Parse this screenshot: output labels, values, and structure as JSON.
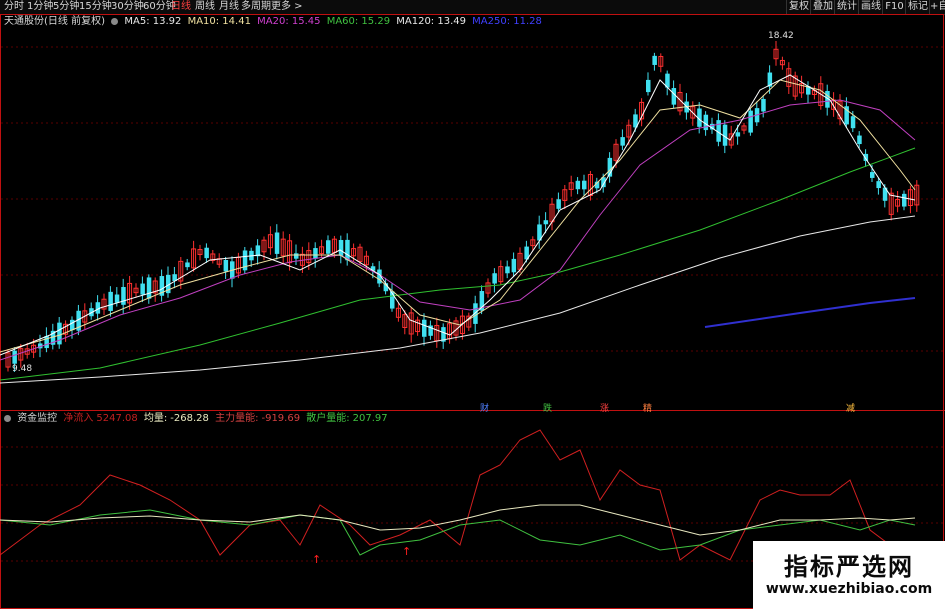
{
  "toolbar": {
    "left_tabs": [
      "分时",
      "1分钟",
      "5分钟",
      "15分钟",
      "30分钟",
      "60分钟",
      "日线",
      "周线",
      "月线",
      "多周期",
      "更多 >"
    ],
    "active_tab": "日线",
    "right_buttons": [
      "复权",
      "叠加",
      "统计",
      "画线",
      "F10",
      "标记",
      "+自"
    ]
  },
  "main_panel": {
    "title": "天通股份(日线 前复权)",
    "ma_legend": [
      {
        "label": "MA5: 13.92",
        "color": "#e8e8e8"
      },
      {
        "label": "MA10: 14.41",
        "color": "#f0e0a0"
      },
      {
        "label": "MA20: 15.45",
        "color": "#d040d0"
      },
      {
        "label": "MA60: 15.29",
        "color": "#40c040"
      },
      {
        "label": "MA120: 13.49",
        "color": "#e8e8e8"
      },
      {
        "label": "MA250: 11.28",
        "color": "#4040ff"
      }
    ],
    "high_price_label": "18.42",
    "low_price_label": "9.48",
    "events": [
      {
        "label": "财",
        "color": "#5080ff"
      },
      {
        "label": "跌",
        "color": "#40c040"
      },
      {
        "label": "涨",
        "color": "#ff4040"
      },
      {
        "label": "精",
        "color": "#ff8040"
      },
      {
        "label": "减",
        "color": "#ffc040"
      }
    ]
  },
  "sub_panel": {
    "title": "资金监控",
    "legend": [
      {
        "label": "净流入",
        "value": "5247.08",
        "color": "#c02020"
      },
      {
        "label": "均量:",
        "value": "-268.28",
        "color": "#e8e8c0"
      },
      {
        "label": "主力量能:",
        "value": "-919.69",
        "color": "#d04040"
      },
      {
        "label": "散户量能:",
        "value": "207.97",
        "color": "#40c040"
      }
    ],
    "arrows": [
      "↑",
      "↑"
    ]
  },
  "watermark": {
    "cn": "指标严选网",
    "en": "www.xuezhibiao.com"
  },
  "colors": {
    "up": "#ff3030",
    "down": "#40e0f0",
    "grid": "#5a0000",
    "border": "#c01010"
  }
}
